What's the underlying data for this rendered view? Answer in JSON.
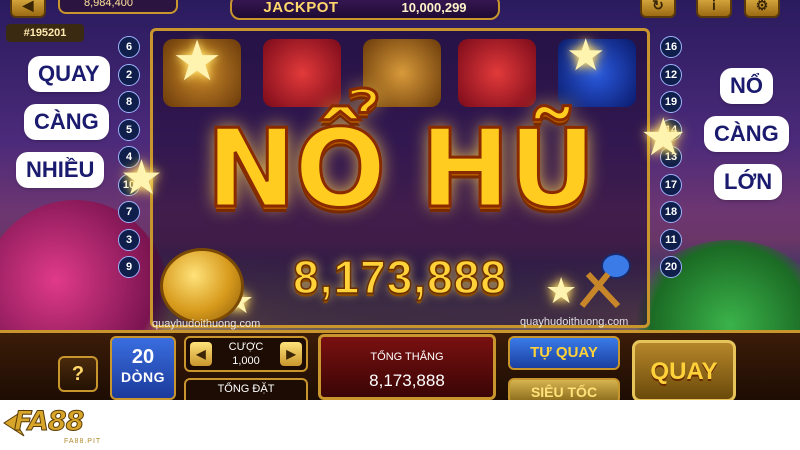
{
  "game": {
    "balance": "8,984,400",
    "jackpot_label": "JACKPOT",
    "jackpot_value": "10,000,299",
    "room_id": "#195201",
    "big_win_title": "NỔ HŨ",
    "big_win_amount": "8,173,888",
    "watermark": "quayhudoithuong.com"
  },
  "paylines": {
    "left": [
      "6",
      "2",
      "8",
      "5",
      "4",
      "10",
      "7",
      "3",
      "9"
    ],
    "right": [
      "16",
      "12",
      "19",
      "14",
      "13",
      "17",
      "18",
      "11",
      "20"
    ]
  },
  "slogans": {
    "left": [
      "QUAY",
      "CÀNG",
      "NHIỀU"
    ],
    "right": [
      "NỔ",
      "CÀNG",
      "LỚN"
    ]
  },
  "controls": {
    "help": "?",
    "lines_value": "20",
    "lines_label": "DÒNG",
    "bet_label": "CƯỢC",
    "bet_value": "1,000",
    "total_bet_label": "TỔNG ĐẶT",
    "win_label": "TỔNG THẮNG",
    "win_value": "8,173,888",
    "auto_spin": "TỰ QUAY",
    "turbo": "SIÊU TỐC",
    "spin": "QUAY"
  },
  "logo": {
    "text": "FA88",
    "subtext": "FA88.PIT"
  },
  "colors": {
    "gold": "#ffcc1f",
    "panel": "#3b1c08",
    "accent_blue": "#3a6ee0"
  }
}
